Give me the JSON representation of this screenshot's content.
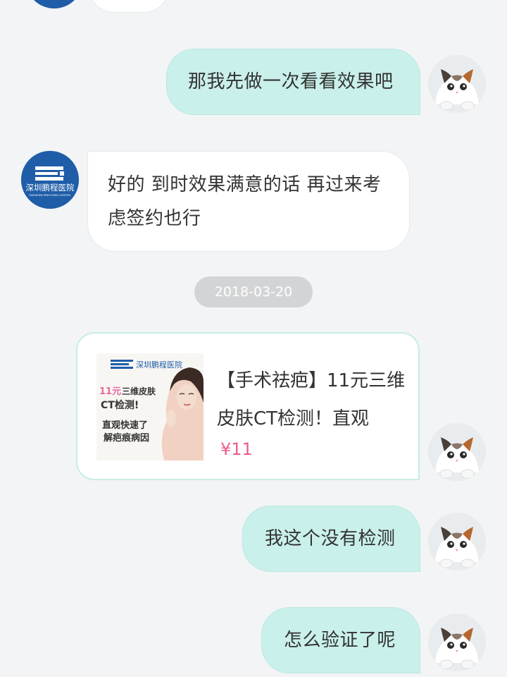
{
  "messages": [
    {
      "text": "那我先做一次看看效果吧"
    },
    {
      "text": "好的 到时效果满意的话 再过来考虑签约也行"
    },
    {
      "text": "我这个没有检测"
    },
    {
      "text": "怎么验证了呢"
    }
  ],
  "timestamp": "2018-03-20",
  "product_card": {
    "title": "【手术祛疤】11元三维皮肤CT检测！直观",
    "price": "¥11",
    "thumb": {
      "brand": "深圳鹏程医院",
      "line1_num": "11元",
      "line1_text": "三维皮肤",
      "line2": "CT检测!",
      "line3": "直观快速了",
      "line4": "解疤痕病因"
    }
  },
  "hospital_logo_text": "深圳鹏程医院",
  "hospital_logo_sub": "SHENZHEN PENGCHENG HOSPITAL",
  "colors": {
    "background": "#f2f4f6",
    "my_bubble": "#c9f0ea",
    "their_bubble": "#ffffff",
    "hospital_blue": "#1f5da8",
    "price_pink": "#ee5a8f"
  }
}
